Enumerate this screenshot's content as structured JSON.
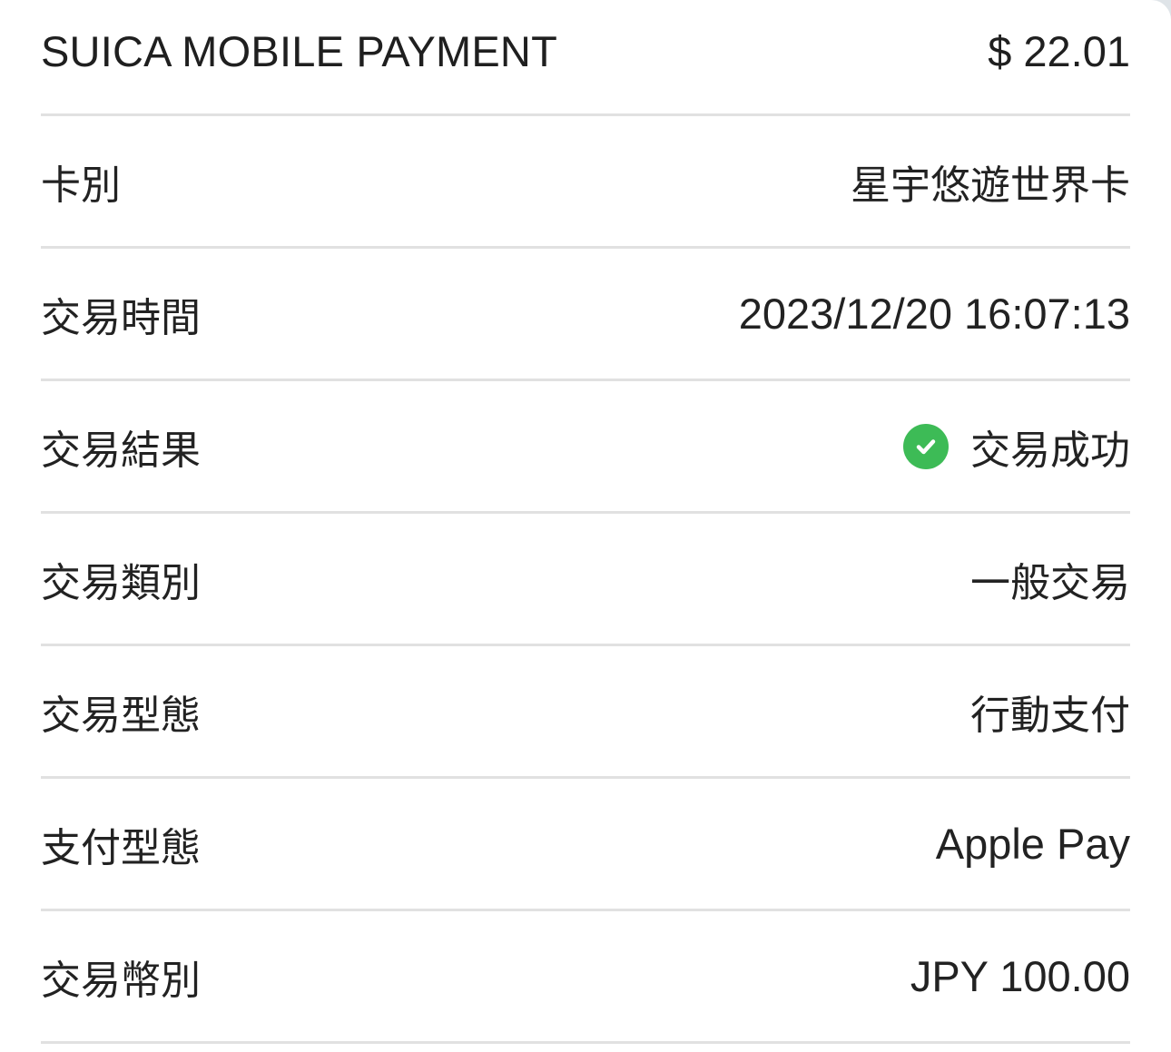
{
  "header": {
    "merchant": "SUICA MOBILE PAYMENT",
    "amount": "$ 22.01"
  },
  "details": [
    {
      "label": "卡別",
      "value": "星宇悠遊世界卡"
    },
    {
      "label": "交易時間",
      "value": "2023/12/20 16:07:13"
    },
    {
      "label": "交易結果",
      "value": "交易成功"
    },
    {
      "label": "交易類別",
      "value": "一般交易"
    },
    {
      "label": "交易型態",
      "value": "行動支付"
    },
    {
      "label": "支付型態",
      "value": "Apple Pay"
    },
    {
      "label": "交易幣別",
      "value": "JPY 100.00"
    }
  ],
  "status": {
    "icon": "check-circle-icon",
    "color": "#3dbb56"
  }
}
